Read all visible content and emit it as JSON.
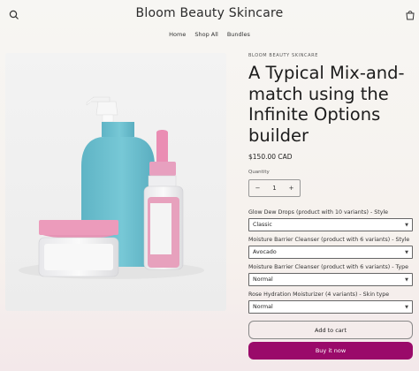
{
  "header": {
    "site_title": "Bloom Beauty Skincare",
    "nav": [
      "Home",
      "Shop All",
      "Bundles"
    ],
    "icons": {
      "search": "search-icon",
      "cart": "bag-icon"
    }
  },
  "product": {
    "vendor": "BLOOM BEAUTY SKINCARE",
    "title": "A Typical Mix-and-match using the Infinite Options builder",
    "price": "$150.00 CAD",
    "quantity_label": "Quantity",
    "quantity_value": "1",
    "minus_label": "−",
    "plus_label": "+",
    "options": [
      {
        "label": "Glow Dew Drops (product with 10 variants) - Style",
        "value": "Classic"
      },
      {
        "label": "Moisture Barrier Cleanser (product with 6 variants) - Style",
        "value": "Avocado"
      },
      {
        "label": "Moisture Barrier Cleanser (product with 6 variants) - Type",
        "value": "Normal"
      },
      {
        "label": "Rose Hydration Moisturizer (4 variants) - Skin type",
        "value": "Normal"
      }
    ],
    "add_to_cart": "Add to cart",
    "buy_now": "Buy it now"
  },
  "colors": {
    "accent": "#9a0a6a",
    "bottle_blue": "#6bbfcf",
    "pink": "#e98db0"
  }
}
